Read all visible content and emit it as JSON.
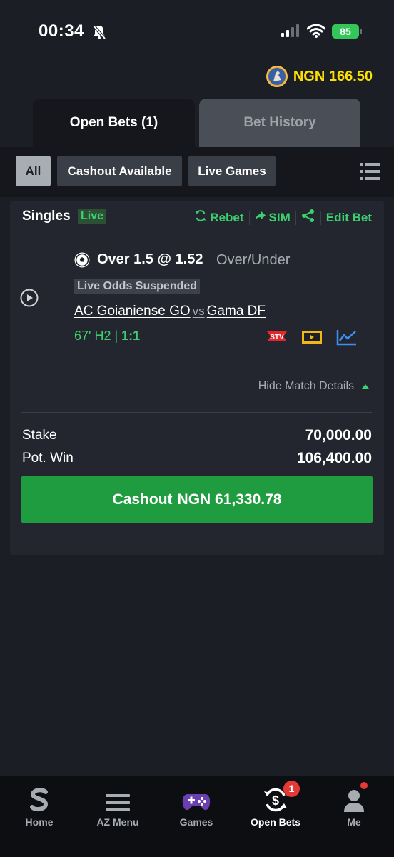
{
  "status_bar": {
    "time": "00:34",
    "battery": "85",
    "colors": {
      "battery": "#33c759"
    }
  },
  "balance": {
    "text": "NGN 166.50",
    "color": "#ffe100"
  },
  "tabs": [
    {
      "label": "Open Bets (1)",
      "active": true
    },
    {
      "label": "Bet History",
      "active": false
    }
  ],
  "filters": {
    "chips": [
      {
        "label": "All",
        "selected": true
      },
      {
        "label": "Cashout Available",
        "selected": false
      },
      {
        "label": "Live Games",
        "selected": false
      }
    ],
    "list_icon": "list-icon"
  },
  "bet": {
    "type": "Singles",
    "live_tag": "Live",
    "actions": {
      "rebet": "Rebet",
      "sim": "SIM",
      "edit": "Edit Bet"
    },
    "selection": {
      "market": "Over 1.5 @ 1.52",
      "market_type": "Over/Under",
      "status": "Live Odds Suspended",
      "home_team": "AC Goianiense GO",
      "vs": "vs",
      "away_team": "Gama DF",
      "match_time": "67' H2 | ",
      "score": "1:1"
    },
    "hide_details": "Hide Match Details",
    "stake_label": "Stake",
    "stake_value": "70,000.00",
    "potwin_label": "Pot. Win",
    "potwin_value": "106,400.00",
    "cashout_label": "Cashout",
    "cashout_amount": "NGN 61,330.78",
    "colors": {
      "accent_green": "#3bd16f",
      "cashout_button": "#1f9c3f"
    }
  },
  "bottom_nav": [
    {
      "label": "Home",
      "icon": "sporty-logo-icon",
      "active": false
    },
    {
      "label": "AZ Menu",
      "icon": "hamburger-menu-icon",
      "active": false
    },
    {
      "label": "Games",
      "icon": "gamepad-icon",
      "active": false
    },
    {
      "label": "Open Bets",
      "icon": "cashout-cycle-icon",
      "active": true,
      "badge": "1"
    },
    {
      "label": "Me",
      "icon": "user-icon",
      "active": false
    }
  ]
}
